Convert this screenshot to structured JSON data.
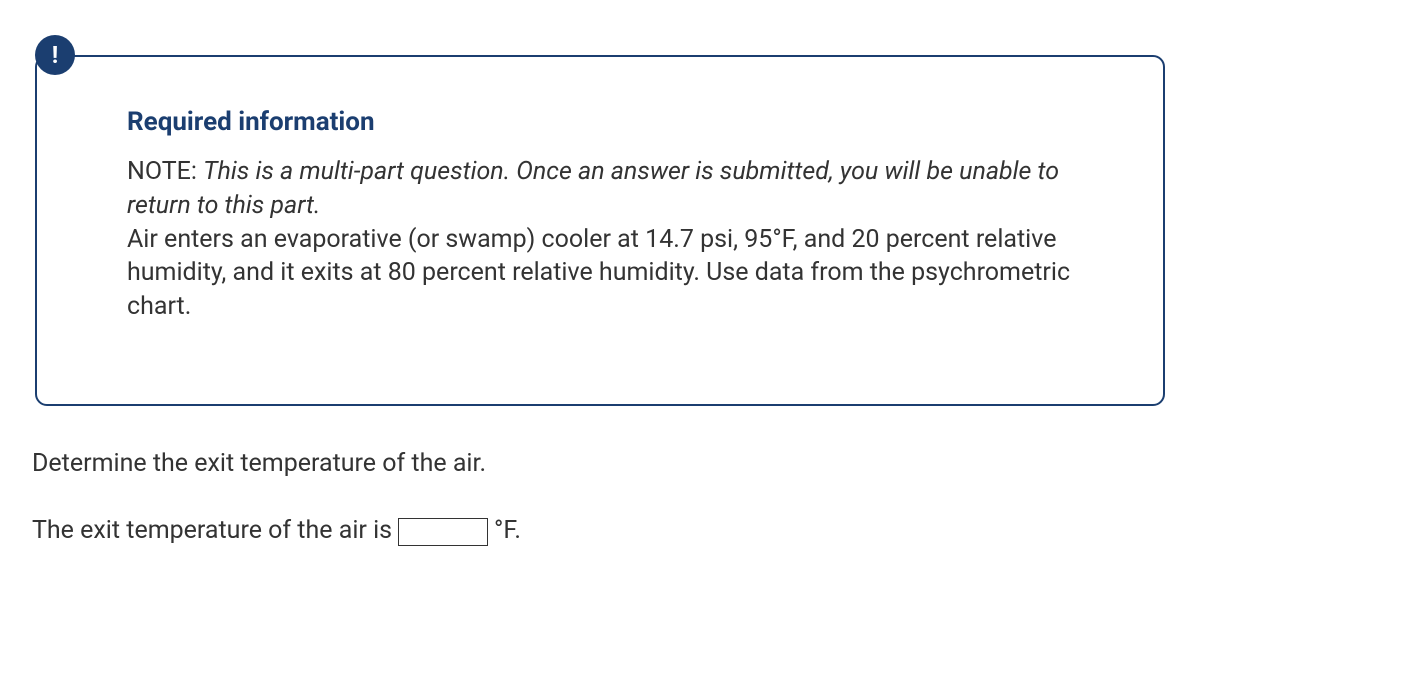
{
  "info_box": {
    "badge_char": "!",
    "title": "Required information",
    "note_label": "NOTE:",
    "note_italic": "This is a multi-part question. Once an answer is submitted, you will be unable to return to this part.",
    "body_text": "Air enters an evaporative (or swamp) cooler at 14.7 psi, 95°F, and 20 percent relative humidity, and it exits at 80 percent relative humidity. Use data from the psychrometric chart."
  },
  "question": {
    "prompt": "Determine the exit temperature of the air.",
    "answer_prefix": "The exit temperature of the air is",
    "answer_value": "",
    "answer_unit": "°F."
  }
}
